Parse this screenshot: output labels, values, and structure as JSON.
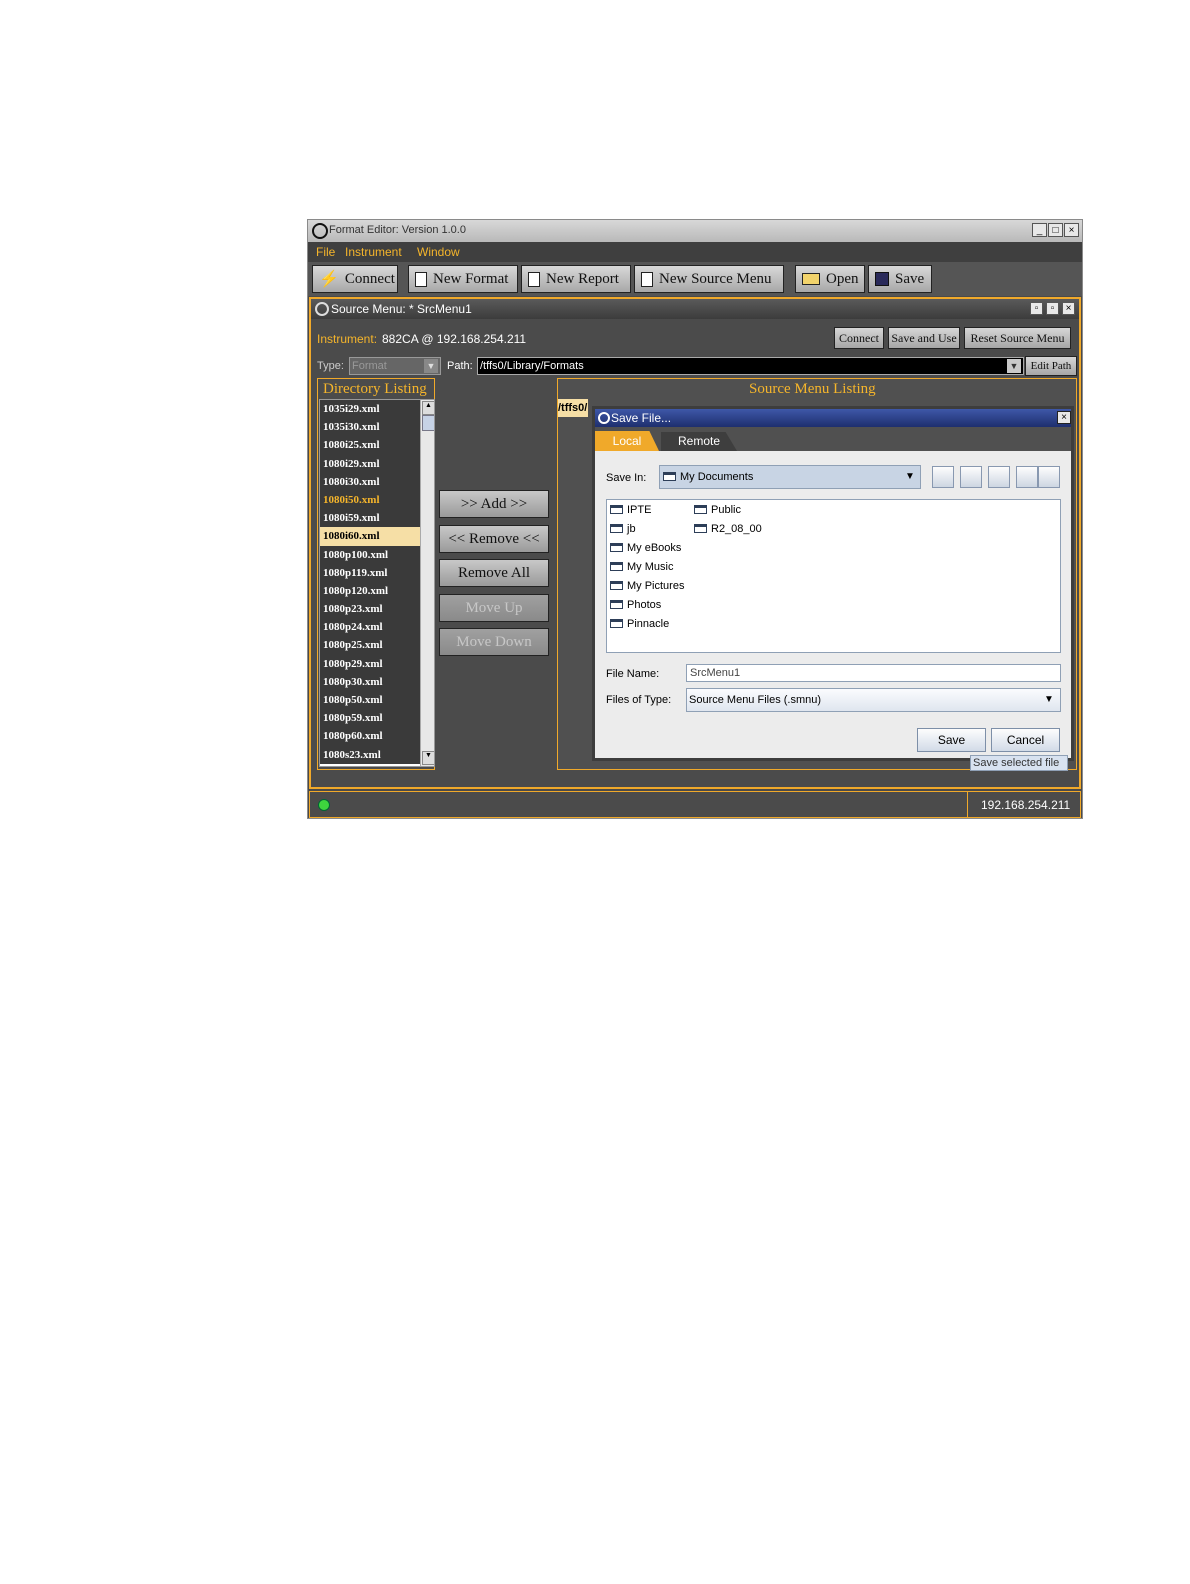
{
  "window": {
    "title": "Format Editor: Version 1.0.0",
    "minimize": "_",
    "maximize": "□",
    "close": "×"
  },
  "menu": [
    "File",
    "Instrument",
    "Window"
  ],
  "toolbar": {
    "connect": "Connect",
    "new_format": "New Format",
    "new_report": "New Report",
    "new_source_menu": "New Source Menu",
    "open": "Open",
    "save": "Save"
  },
  "source_menu": {
    "title": "Source Menu:  * SrcMenu1",
    "instrument_label": "Instrument:",
    "instrument_value": "882CA @ 192.168.254.211",
    "connect": "Connect",
    "save_and_use": "Save and Use",
    "reset": "Reset Source Menu",
    "type_label": "Type:",
    "type_value": "Format",
    "path_label": "Path:",
    "path_value": "/tffs0/Library/Formats",
    "edit_path": "Edit Path",
    "directory_header": "Directory Listing",
    "source_header": "Source Menu Listing",
    "source_path_stub": "/tffs0/",
    "files": [
      "1035i29.xml",
      "1035i30.xml",
      "1080i25.xml",
      "1080i29.xml",
      "1080i30.xml",
      "1080i50.xml",
      "1080i59.xml",
      "1080i60.xml",
      "1080p100.xml",
      "1080p119.xml",
      "1080p120.xml",
      "1080p23.xml",
      "1080p24.xml",
      "1080p25.xml",
      "1080p29.xml",
      "1080p30.xml",
      "1080p50.xml",
      "1080p59.xml",
      "1080p60.xml",
      "1080s23.xml"
    ],
    "add": ">> Add >>",
    "remove": "<< Remove <<",
    "remove_all": "Remove All",
    "move_up": "Move Up",
    "move_down": "Move Down"
  },
  "dialog": {
    "title": "Save File...",
    "tab_local": "Local",
    "tab_remote": "Remote",
    "save_in_label": "Save In:",
    "save_in_value": "My Documents",
    "folders_col1": [
      "IPTE",
      "jb",
      "My eBooks",
      "My Music",
      "My Pictures",
      "Photos",
      "Pinnacle"
    ],
    "folders_col2": [
      "Public",
      "R2_08_00"
    ],
    "file_name_label": "File Name:",
    "file_name_value": "SrcMenu1",
    "files_of_type_label": "Files of Type:",
    "files_of_type_value": "Source Menu Files (.smnu)",
    "save": "Save",
    "cancel": "Cancel",
    "tooltip": "Save selected file"
  },
  "status": {
    "ip": "192.168.254.211"
  }
}
